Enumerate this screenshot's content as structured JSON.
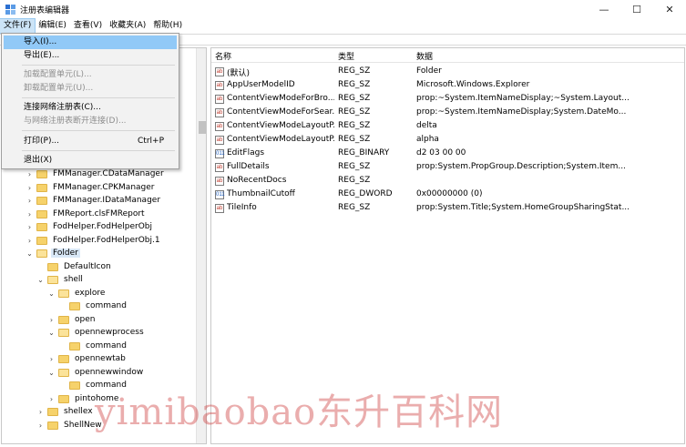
{
  "window": {
    "title": "注册表编辑器",
    "controls": [
      "—",
      "☐",
      "✕"
    ]
  },
  "menubar": [
    {
      "label": "文件(F)"
    },
    {
      "label": "编辑(E)"
    },
    {
      "label": "查看(V)"
    },
    {
      "label": "收藏夹(A)"
    },
    {
      "label": "帮助(H)"
    }
  ],
  "file_menu": {
    "items": [
      {
        "label": "导入(I)...",
        "state": "highlighted"
      },
      {
        "label": "导出(E)...",
        "state": "normal"
      },
      {
        "label": "加载配置单元(L)...",
        "state": "disabled"
      },
      {
        "label": "卸载配置单元(U)...",
        "state": "disabled"
      },
      {
        "label": "连接网络注册表(C)...",
        "state": "normal"
      },
      {
        "label": "与网络注册表断开连接(D)...",
        "state": "disabled"
      },
      {
        "label": "打印(P)...",
        "state": "normal",
        "shortcut": "Ctrl+P"
      },
      {
        "label": "退出(X)",
        "state": "normal"
      }
    ]
  },
  "tree": [
    {
      "label": "FMManager.CDataManager",
      "expander": "›"
    },
    {
      "label": "FMManager.CPKManager",
      "expander": "›"
    },
    {
      "label": "FMManager.IDataManager",
      "expander": "›"
    },
    {
      "label": "FMReport.clsFMReport",
      "expander": "›"
    },
    {
      "label": "FodHelper.FodHelperObj",
      "expander": "›"
    },
    {
      "label": "FodHelper.FodHelperObj.1",
      "expander": "›"
    },
    {
      "label": "Folder",
      "expander": "⌄",
      "selected": true
    },
    {
      "label": "DefaultIcon",
      "expander": ""
    },
    {
      "label": "shell",
      "expander": "⌄"
    },
    {
      "label": "explore",
      "expander": "⌄"
    },
    {
      "label": "command",
      "expander": ""
    },
    {
      "label": "open",
      "expander": "›"
    },
    {
      "label": "opennewprocess",
      "expander": "⌄"
    },
    {
      "label": "command",
      "expander": ""
    },
    {
      "label": "opennewtab",
      "expander": "›"
    },
    {
      "label": "opennewwindow",
      "expander": "⌄"
    },
    {
      "label": "command",
      "expander": ""
    },
    {
      "label": "pintohome",
      "expander": "›"
    },
    {
      "label": "shellex",
      "expander": "›"
    },
    {
      "label": "ShellNew",
      "expander": "›"
    }
  ],
  "list": {
    "headers": {
      "name": "名称",
      "type": "类型",
      "data": "数据"
    },
    "rows": [
      {
        "icon": "ab",
        "name": "(默认)",
        "type": "REG_SZ",
        "data": "Folder"
      },
      {
        "icon": "ab",
        "name": "AppUserModelID",
        "type": "REG_SZ",
        "data": "Microsoft.Windows.Explorer"
      },
      {
        "icon": "ab",
        "name": "ContentViewModeForBro...",
        "type": "REG_SZ",
        "data": "prop:~System.ItemNameDisplay;~System.Layout..."
      },
      {
        "icon": "ab",
        "name": "ContentViewModeForSear...",
        "type": "REG_SZ",
        "data": "prop:~System.ItemNameDisplay;System.DateMo..."
      },
      {
        "icon": "ab",
        "name": "ContentViewModeLayoutP...",
        "type": "REG_SZ",
        "data": "delta"
      },
      {
        "icon": "ab",
        "name": "ContentViewModeLayoutP...",
        "type": "REG_SZ",
        "data": "alpha"
      },
      {
        "icon": "011",
        "name": "EditFlags",
        "type": "REG_BINARY",
        "data": "d2 03 00 00"
      },
      {
        "icon": "ab",
        "name": "FullDetails",
        "type": "REG_SZ",
        "data": "prop:System.PropGroup.Description;System.Item..."
      },
      {
        "icon": "ab",
        "name": "NoRecentDocs",
        "type": "REG_SZ",
        "data": ""
      },
      {
        "icon": "011",
        "name": "ThumbnailCutoff",
        "type": "REG_DWORD",
        "data": "0x00000000 (0)"
      },
      {
        "icon": "ab",
        "name": "TileInfo",
        "type": "REG_SZ",
        "data": "prop:System.Title;System.HomeGroupSharingStat..."
      }
    ]
  },
  "watermark": "yimibaobao东升百科网"
}
